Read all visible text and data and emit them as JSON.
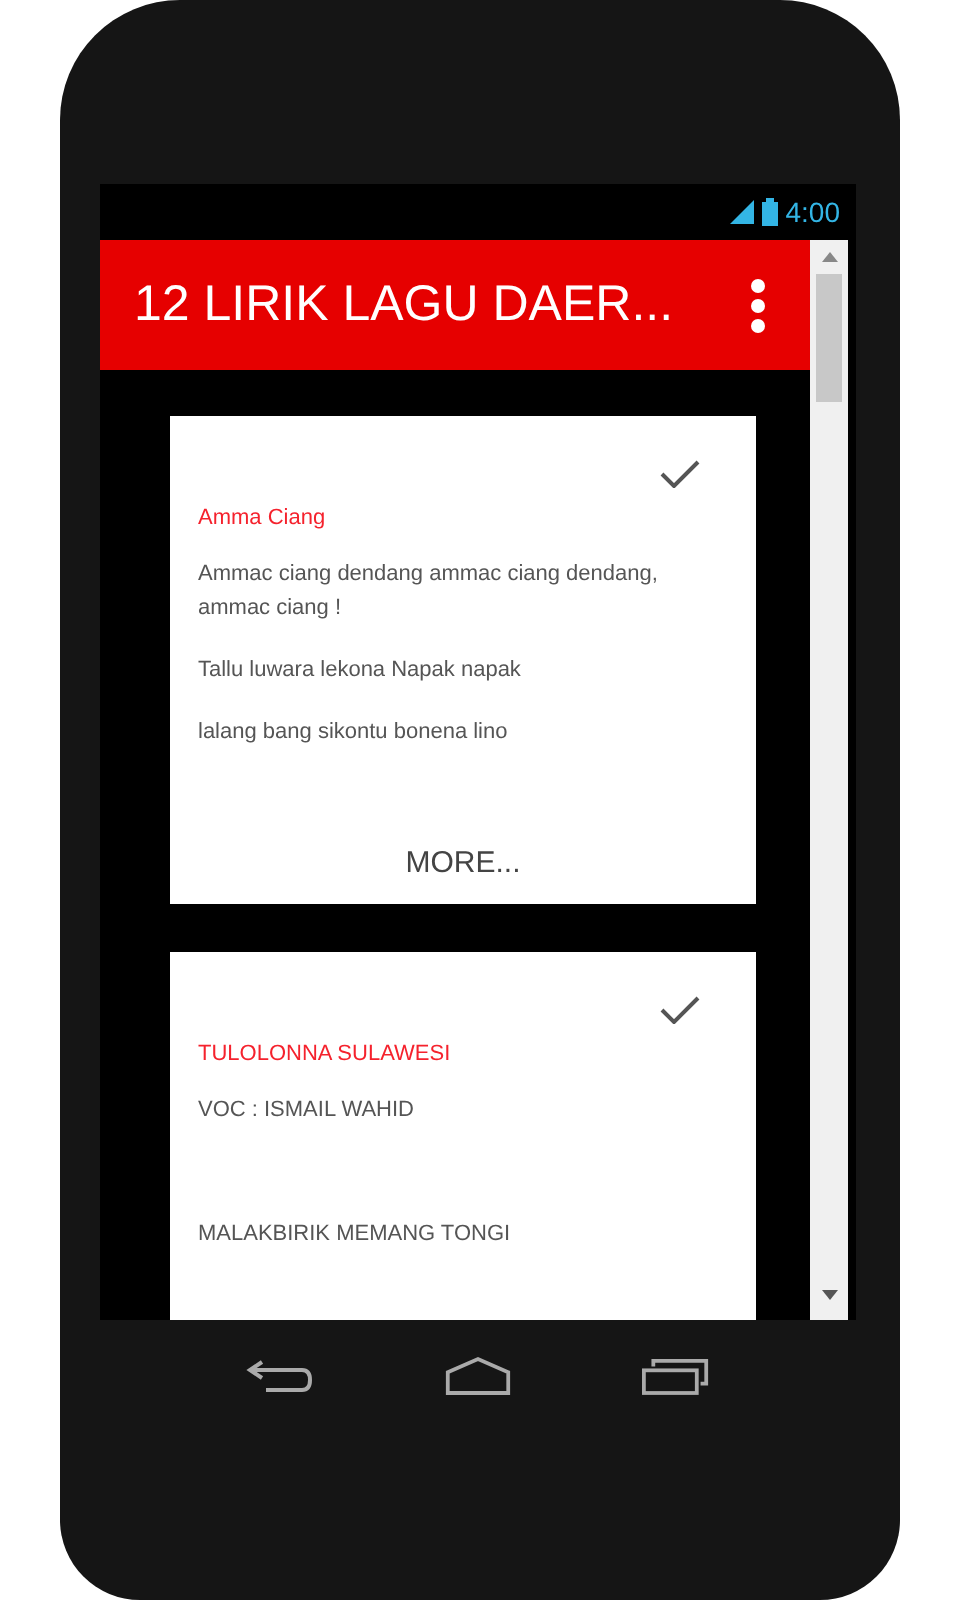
{
  "status_bar": {
    "time": "4:00"
  },
  "app_bar": {
    "title": "12 LIRIK LAGU DAER..."
  },
  "cards": [
    {
      "title": "Amma Ciang",
      "lines": [
        "Ammac ciang dendang ammac ciang dendang, ammac ciang !",
        "Tallu luwara lekona Napak napak",
        "lalang bang sikontu bonena lino"
      ],
      "more": "MORE..."
    },
    {
      "title": "TULOLONNA SULAWESI",
      "lines": [
        "VOC : ISMAIL WAHID",
        "MALAKBIRIK MEMANG TONGI"
      ]
    }
  ]
}
